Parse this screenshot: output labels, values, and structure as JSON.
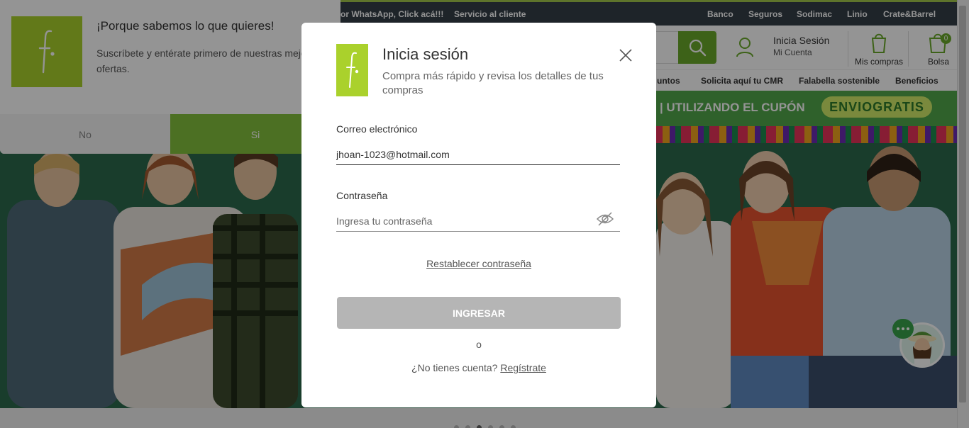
{
  "topbar": {
    "whatsapp": "or WhatsApp, Click acá!!!",
    "servicio": "Servicio al cliente",
    "links": [
      "Banco",
      "Seguros",
      "Sodimac",
      "Linio",
      "Crate&Barrel"
    ]
  },
  "header": {
    "login_title": "Inicia Sesión",
    "login_sub": "Mi Cuenta",
    "mis_compras": "Mis compras",
    "bolsa": "Bolsa",
    "bolsa_count": "0"
  },
  "nav": [
    "untos",
    "Solicita aquí tu CMR",
    "Falabella sostenible",
    "Beneficios"
  ],
  "promo": {
    "text": "O | UTILIZANDO EL CUPÓN",
    "coupon": "ENVIOGRATIS"
  },
  "subscribe": {
    "title": "¡Porque sabemos lo que quieres!",
    "body": "Suscríbete y entérate primero de nuestras mejo ofertas.",
    "no_label": "No",
    "si_label": "Si"
  },
  "modal": {
    "title": "Inicia sesión",
    "subtitle": "Compra más rápido y revisa los detalles de tus compras",
    "email_label": "Correo electrónico",
    "email_value": "jhoan-1023@hotmail.com",
    "password_label": "Contraseña",
    "password_placeholder": "Ingresa tu contraseña",
    "reset_link": "Restablecer contraseña",
    "submit_label": "INGRESAR",
    "or_text": "o",
    "register_prompt": "¿No tienes cuenta?",
    "register_link": "Regístrate"
  },
  "colors": {
    "brand_green": "#aad12c",
    "button_disabled": "#b5b5b5",
    "topbar": "#343e48",
    "promo_green": "#52a84a"
  },
  "icons": [
    "falabella-logo-icon",
    "close-icon",
    "eye-off-icon",
    "search-icon",
    "user-icon",
    "bag-icon",
    "chat-icon"
  ]
}
